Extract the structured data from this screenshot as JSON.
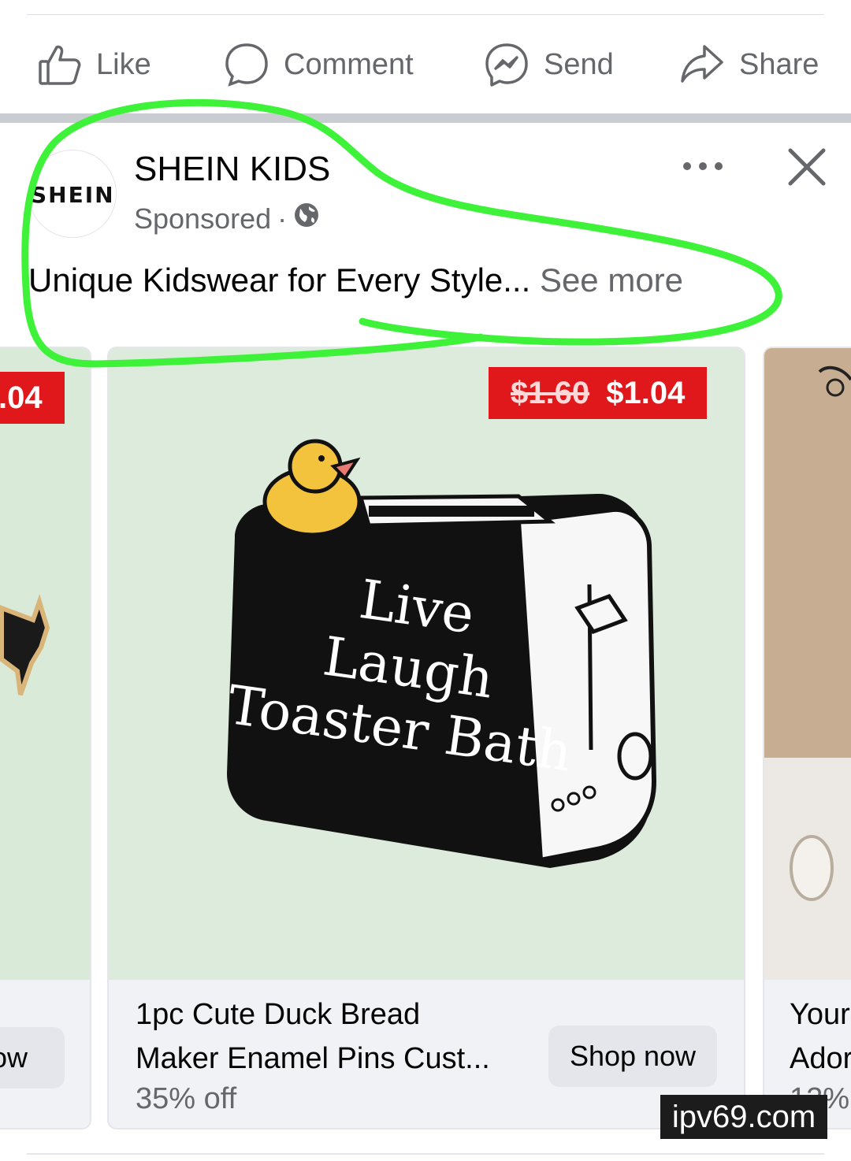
{
  "actions": {
    "like": "Like",
    "comment": "Comment",
    "send": "Send",
    "share": "Share"
  },
  "ad": {
    "logo_text": "SHEIN",
    "page_name": "SHEIN KIDS",
    "sponsored": "Sponsored",
    "dot_separator": "·",
    "caption": "Unique Kidswear for Every Style...",
    "see_more": "See more"
  },
  "carousel": {
    "left_card": {
      "price_partial": ".04",
      "button_partial": "ow"
    },
    "main_card": {
      "old_price": "$1.60",
      "new_price": "$1.04",
      "image_text_line1": "Live",
      "image_text_line2": "Laugh",
      "image_text_line3": "Toaster Bath",
      "title_line1": "1pc Cute Duck Bread",
      "title_line2": "Maker Enamel Pins Cust...",
      "discount": "35% off",
      "button": "Shop now"
    },
    "right_card": {
      "title_line1": "Your",
      "title_line2": "Ador",
      "discount_partial": "12%"
    }
  },
  "watermark": "ipv69.com",
  "colors": {
    "price_red": "#e0171b",
    "icon_gray": "#65676b",
    "highlight_green": "#3ef23a",
    "image_bg": "#dcebdc"
  }
}
